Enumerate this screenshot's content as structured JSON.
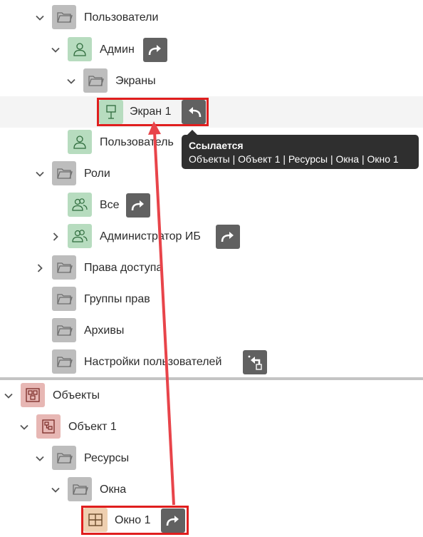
{
  "tree": {
    "items": [
      {
        "label": "Пользователи",
        "icon": "folder-icon"
      },
      {
        "label": "Админ",
        "icon": "user-icon",
        "action": "link-out-icon"
      },
      {
        "label": "Экраны",
        "icon": "folder-icon"
      },
      {
        "label": "Экран 1",
        "icon": "screen-icon",
        "action": "link-back-icon",
        "selected": true
      },
      {
        "label": "Пользователь",
        "icon": "user-icon"
      },
      {
        "label": "Роли",
        "icon": "folder-icon"
      },
      {
        "label": "Все",
        "icon": "users-icon",
        "action": "link-out-icon"
      },
      {
        "label": "Администратор ИБ",
        "icon": "users-icon",
        "action": "link-out-icon"
      },
      {
        "label": "Права доступа",
        "icon": "folder-icon"
      },
      {
        "label": "Группы прав",
        "icon": "folder-icon"
      },
      {
        "label": "Архивы",
        "icon": "folder-icon"
      },
      {
        "label": "Настройки пользователей",
        "icon": "folder-icon",
        "action": "settings-link-icon"
      },
      {
        "label": "Объекты",
        "icon": "objects-icon"
      },
      {
        "label": "Объект 1",
        "icon": "object-icon"
      },
      {
        "label": "Ресурсы",
        "icon": "folder-icon"
      },
      {
        "label": "Окна",
        "icon": "folder-icon"
      },
      {
        "label": "Окно 1",
        "icon": "window-icon",
        "action": "link-out-icon",
        "selected": true
      }
    ]
  },
  "tooltip": {
    "title": "Ссылается",
    "path": "Объекты | Объект 1 | Ресурсы | Окна | Окно 1"
  },
  "colors": {
    "folder": "#bdbdbd",
    "user": "#b7dcbf",
    "object": "#e7b7b4",
    "window": "#eecfb0",
    "action": "#616161",
    "highlight": "#e01e1e"
  }
}
